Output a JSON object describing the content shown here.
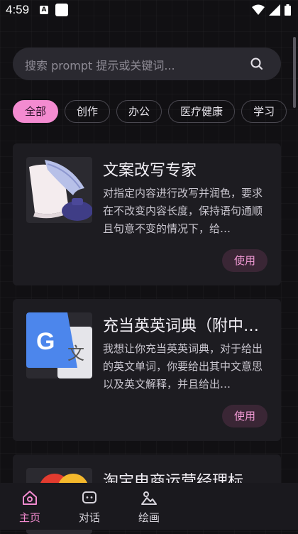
{
  "status_bar": {
    "time": "4:59",
    "badge": "A"
  },
  "search": {
    "placeholder": "搜索 prompt 提示或关键词..."
  },
  "categories": [
    "全部",
    "创作",
    "办公",
    "医疗健康",
    "学习"
  ],
  "cards": [
    {
      "title": "文案改写专家",
      "description": "对指定内容进行改写并润色，要求在不改变内容长度，保持语句通顺且句意不变的情况下，给…",
      "action": "使用"
    },
    {
      "title": "充当英英词典（附中…",
      "description": "我想让你充当英英词典，对于给出的英文单词，你要给出其中文意思以及英文解释，并且给出…",
      "action": "使用"
    },
    {
      "title": "淘宝电商运营经理标…",
      "description": "",
      "action": ""
    }
  ],
  "tabs": [
    {
      "label": "主页",
      "icon": "home-icon"
    },
    {
      "label": "对话",
      "icon": "chat-icon"
    },
    {
      "label": "绘画",
      "icon": "image-icon"
    }
  ],
  "colors": {
    "accent": "#f38bd0",
    "background": "#111013",
    "card": "#1d1c21"
  }
}
